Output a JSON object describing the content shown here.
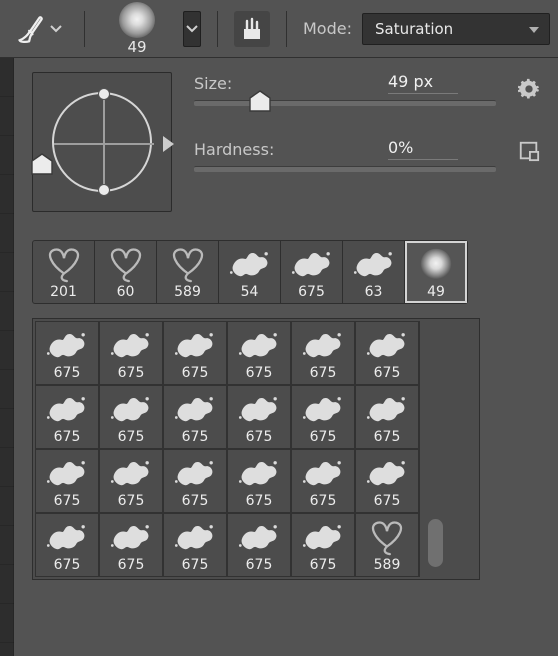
{
  "toolbar": {
    "brush_size_label_under": "49",
    "mode_label": "Mode:",
    "mode_value": "Saturation"
  },
  "panel": {
    "size_label": "Size:",
    "size_value": "49 px",
    "size_slider_pos": 0.22,
    "hardness_label": "Hardness:",
    "hardness_value": "0%",
    "hardness_slider_pos": 0.0
  },
  "recent": [
    {
      "label": "201",
      "thumb": "heart"
    },
    {
      "label": "60",
      "thumb": "heart"
    },
    {
      "label": "589",
      "thumb": "heart"
    },
    {
      "label": "54",
      "thumb": "splatter"
    },
    {
      "label": "675",
      "thumb": "splatter"
    },
    {
      "label": "63",
      "thumb": "splatter"
    },
    {
      "label": "49",
      "thumb": "orb",
      "selected": true
    }
  ],
  "grid": [
    {
      "label": "675",
      "thumb": "splatter"
    },
    {
      "label": "675",
      "thumb": "splatter"
    },
    {
      "label": "675",
      "thumb": "splatter"
    },
    {
      "label": "675",
      "thumb": "splatter"
    },
    {
      "label": "675",
      "thumb": "splatter"
    },
    {
      "label": "675",
      "thumb": "splatter"
    },
    {
      "label": "675",
      "thumb": "splatter"
    },
    {
      "label": "675",
      "thumb": "splatter"
    },
    {
      "label": "675",
      "thumb": "splatter"
    },
    {
      "label": "675",
      "thumb": "splatter"
    },
    {
      "label": "675",
      "thumb": "splatter"
    },
    {
      "label": "675",
      "thumb": "splatter"
    },
    {
      "label": "675",
      "thumb": "splatter"
    },
    {
      "label": "675",
      "thumb": "splatter"
    },
    {
      "label": "675",
      "thumb": "splatter"
    },
    {
      "label": "675",
      "thumb": "splatter"
    },
    {
      "label": "675",
      "thumb": "splatter"
    },
    {
      "label": "675",
      "thumb": "splatter"
    },
    {
      "label": "675",
      "thumb": "splatter"
    },
    {
      "label": "675",
      "thumb": "splatter"
    },
    {
      "label": "675",
      "thumb": "splatter"
    },
    {
      "label": "675",
      "thumb": "splatter"
    },
    {
      "label": "675",
      "thumb": "splatter"
    },
    {
      "label": "589",
      "thumb": "heart"
    }
  ]
}
